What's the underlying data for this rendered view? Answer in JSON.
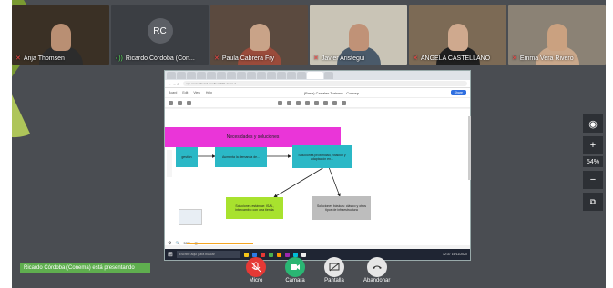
{
  "participants": [
    {
      "name": "Anja Thomsen",
      "mic": "muted",
      "bg": "#3a3025",
      "skin": "#b98f73",
      "shirt": "#2c2c2c"
    },
    {
      "name": "Ricardo Córdoba (Con...",
      "mic": "active",
      "initials": "RC"
    },
    {
      "name": "Paula Cabrera Fry",
      "mic": "muted",
      "bg": "#5b4a3f",
      "skin": "#c9a388",
      "shirt": "#9a4b3b"
    },
    {
      "name": "Javier Aristegui",
      "mic": "muted",
      "bg": "#c9c4b6",
      "skin": "#c09277",
      "shirt": "#4a5a6a"
    },
    {
      "name": "ANGELA CASTELLANO",
      "mic": "muted",
      "bg": "#7c6a55",
      "skin": "#cfa98e",
      "shirt": "#1f1f1f"
    },
    {
      "name": "Emma Vera Rivero",
      "mic": "muted",
      "bg": "#8b8275",
      "skin": "#caa180",
      "shirt": "#c9a78a"
    }
  ],
  "shared_screen": {
    "url": "app.conceptboard.com/board/hh-1a-mr-d...",
    "doc_title": "(Base) Canales Turismo - Concep",
    "menu": [
      "Board",
      "Edit",
      "View",
      "Help"
    ],
    "share_label": "Share",
    "diagram": {
      "header": "Necesidades y soluciones",
      "boxes": [
        {
          "text": "gestión",
          "color": "#2bb8c6"
        },
        {
          "text": "Aumenta la demanda de...",
          "color": "#2bb8c6"
        },
        {
          "text": "Soluciones proximidad, rotación y adaptación en...",
          "color": "#2bb8c6"
        },
        {
          "text": "Soluciones estándar: ISAL, intercambio con otra tienda",
          "color": "#a8e22e"
        },
        {
          "text": "Soluciones básicas: clásico y otros tipos de infraestructura",
          "color": "#bdbdbd"
        }
      ]
    },
    "zoom_label": "50%",
    "taskbar_search": "Escribe aquí para buscar",
    "taskbar_time": "12:37 16/11/2020"
  },
  "side_controls": {
    "zoom_level": "54%",
    "icons": [
      "camera-icon",
      "zoom-in-icon",
      "zoom-out-icon",
      "external-icon"
    ]
  },
  "presenting_notice": "Ricardo Córdoba (Conema) está presentando",
  "controls": [
    {
      "label": "Micro",
      "color": "#e53935",
      "icon": "mic-off-icon"
    },
    {
      "label": "Cámara",
      "color": "#2ab673",
      "icon": "camera-icon"
    },
    {
      "label": "Pantalla",
      "color": "#e6e6e6",
      "icon": "screen-icon"
    },
    {
      "label": "Abandonar",
      "color": "#e6e6e6",
      "icon": "hangup-icon"
    }
  ]
}
